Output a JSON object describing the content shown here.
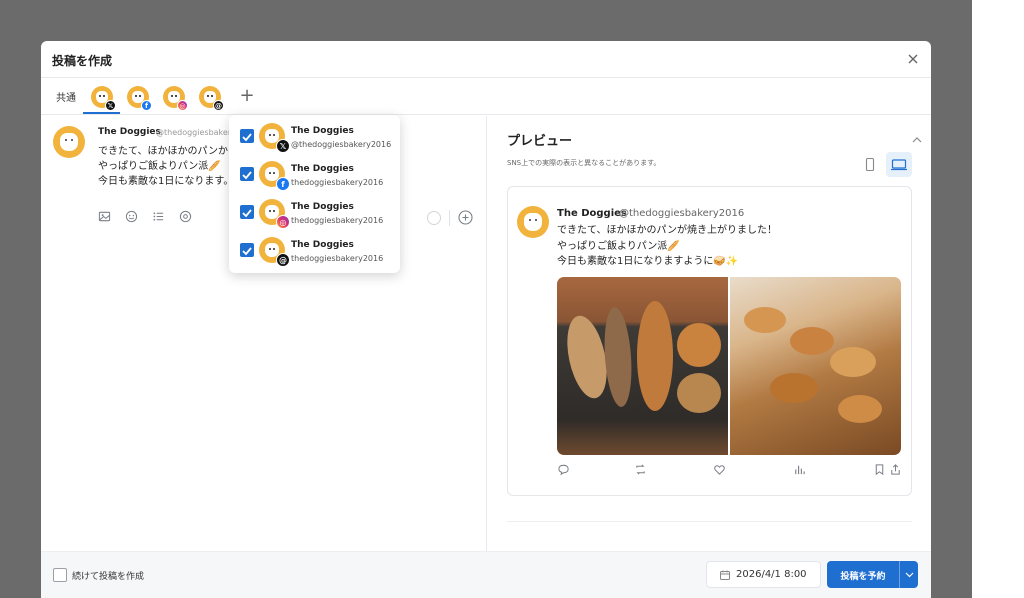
{
  "modal": {
    "title": "投稿を作成"
  },
  "tabs": {
    "common_label": "共通",
    "accounts": [
      {
        "platform": "x",
        "icon": "x-logo-icon"
      },
      {
        "platform": "facebook",
        "icon": "facebook-logo-icon"
      },
      {
        "platform": "instagram",
        "icon": "instagram-logo-icon"
      },
      {
        "platform": "threads",
        "icon": "threads-logo-icon"
      }
    ]
  },
  "composer": {
    "name": "The Doggies",
    "handle": "@thedoggiesbakery",
    "text": "できたて、ほかほかのパンか\nやっぱりご飯よりパン派🥖\n今日も素敵な1日になります。"
  },
  "dropdown": {
    "items": [
      {
        "name": "The Doggies",
        "handle": "@thedoggiesbakery2016",
        "platform": "x",
        "checked": true
      },
      {
        "name": "The Doggies",
        "handle": "thedoggiesbakery2016",
        "platform": "facebook",
        "checked": true
      },
      {
        "name": "The Doggies",
        "handle": "thedoggiesbakery2016",
        "platform": "instagram",
        "checked": true
      },
      {
        "name": "The Doggies",
        "handle": "thedoggiesbakery2016",
        "platform": "threads",
        "checked": true
      }
    ]
  },
  "preview": {
    "title": "プレビュー",
    "note": "SNS上での実際の表示と異なることがあります。",
    "post": {
      "name": "The Doggies",
      "handle": "@thedoggiesbakery2016",
      "text": "できたて、ほかほかのパンが焼き上がりました！\nやっぱりご飯よりパン派🥖\n今日も素敵な1日になりますように🥪✨"
    }
  },
  "footer": {
    "continue_label": "続けて投稿を作成",
    "date": "2026/4/1 8:00",
    "schedule_label": "投稿を予約"
  },
  "colors": {
    "accent": "#1f6fd1",
    "avatar": "#f2b33d",
    "backdrop": "#6b6b6b"
  }
}
